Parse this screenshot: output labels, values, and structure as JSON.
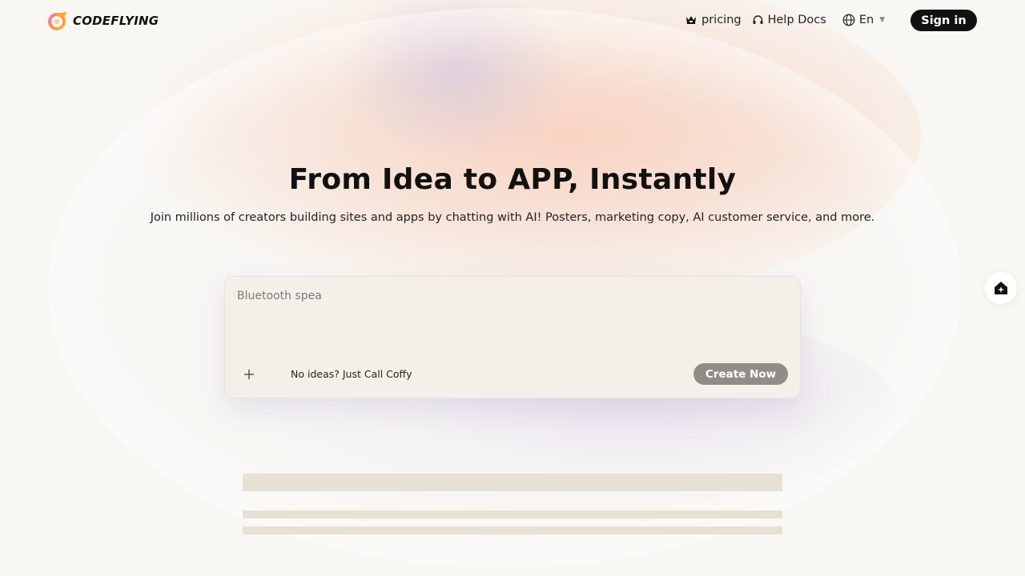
{
  "header": {
    "logo_text": "CODEFLYING",
    "nav": {
      "pricing_label": "pricing",
      "help_label": "Help Docs",
      "language_label": "En"
    },
    "signin_label": "Sign in"
  },
  "hero": {
    "title": "From Idea to APP, Instantly",
    "subtitle": "Join millions of creators building sites and apps by chatting with AI! Posters, marketing copy, AI customer service, and more."
  },
  "prompt": {
    "placeholder": "Bluetooth spea",
    "value": "",
    "hint_label": "No ideas? Just Call Coffy",
    "create_label": "Create Now"
  },
  "icons": {
    "pricing": "crown-icon",
    "help": "headset-icon",
    "language": "globe-icon",
    "language_caret": "caret-down-icon",
    "attach": "plus-icon",
    "float": "home-sparkle-icon"
  },
  "colors": {
    "page_bg": "#f8f7f4",
    "primary_button": "#111111",
    "create_button": "#908d88",
    "card_bg": "#f4efe8",
    "skeleton": "#e7e1d5"
  }
}
